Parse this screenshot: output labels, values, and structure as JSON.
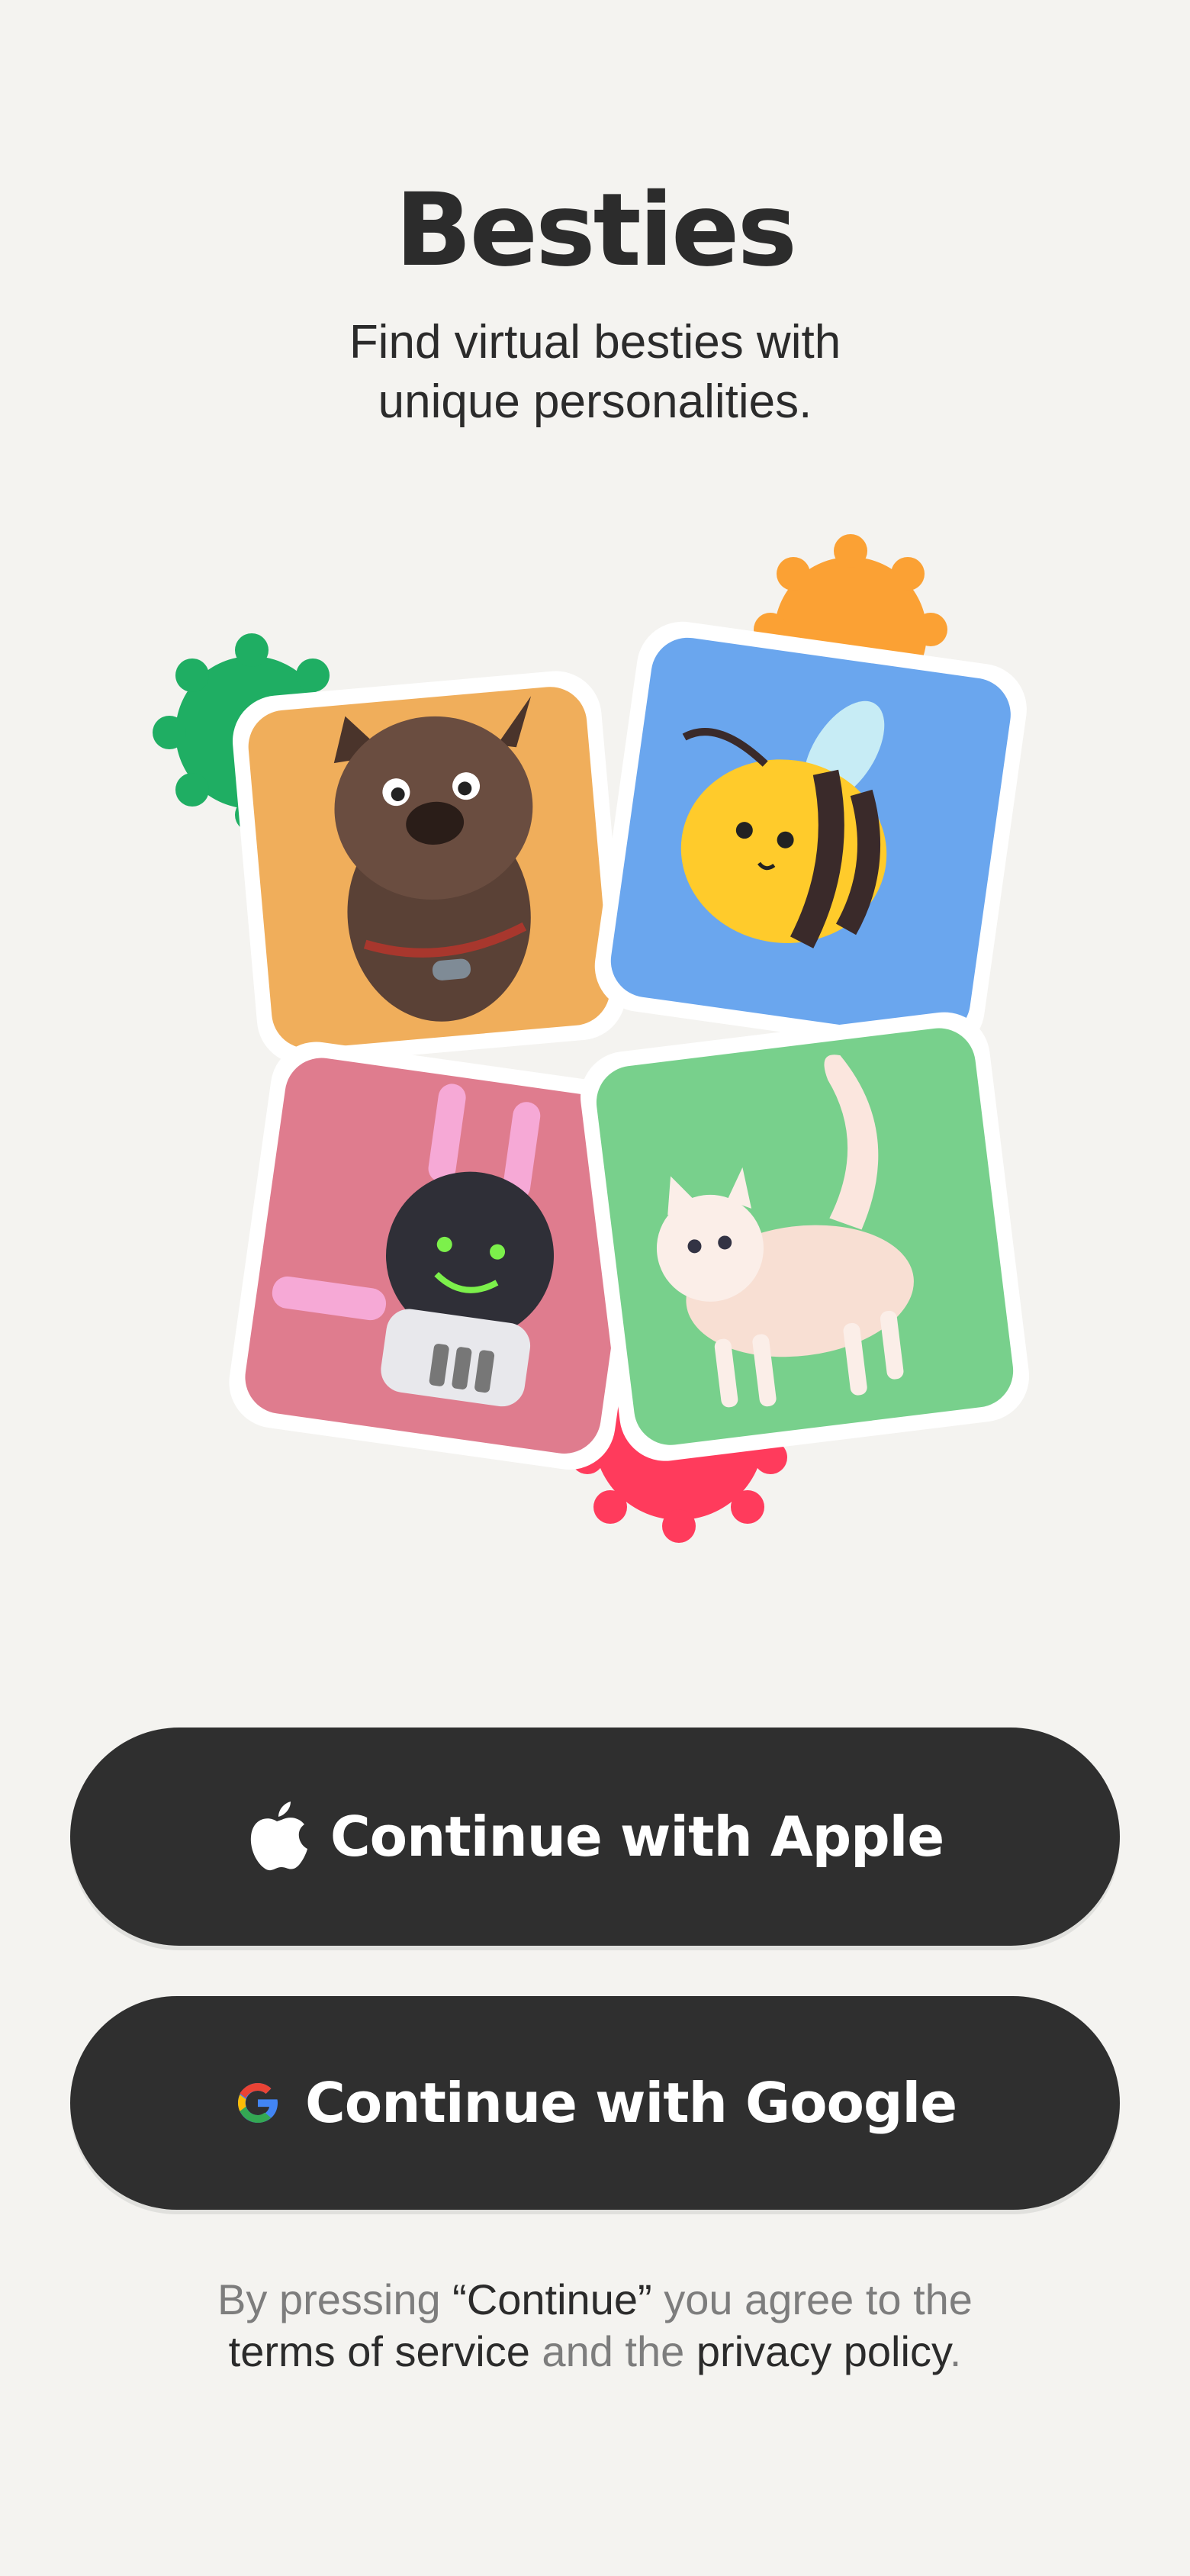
{
  "app": {
    "title": "Besties",
    "subtitle_line1": "Find virtual besties with",
    "subtitle_line2": "unique personalities."
  },
  "collage": {
    "cards": [
      {
        "character": "dog",
        "background": "#f0ae5b"
      },
      {
        "character": "bee",
        "background": "#6aa6ee"
      },
      {
        "character": "robot-bunny",
        "background": "#df7c8e"
      },
      {
        "character": "cat",
        "background": "#78d08c"
      }
    ],
    "badges": [
      {
        "color": "#1fae63",
        "icon": "green-badge-icon"
      },
      {
        "color": "#fba134",
        "icon": "orange-badge-icon"
      },
      {
        "color": "#ff3b5c",
        "icon": "red-badge-icon"
      }
    ]
  },
  "auth": {
    "apple_label": "Continue with Apple",
    "apple_icon": "apple-icon",
    "google_label": "Continue with Google",
    "google_icon": "google-icon"
  },
  "legal": {
    "prefix": "By pressing ",
    "continue_quote": "“Continue”",
    "middle": " you agree to the",
    "terms_link": "terms of service",
    "and_the": " and the ",
    "privacy_link": "privacy policy",
    "period": "."
  }
}
